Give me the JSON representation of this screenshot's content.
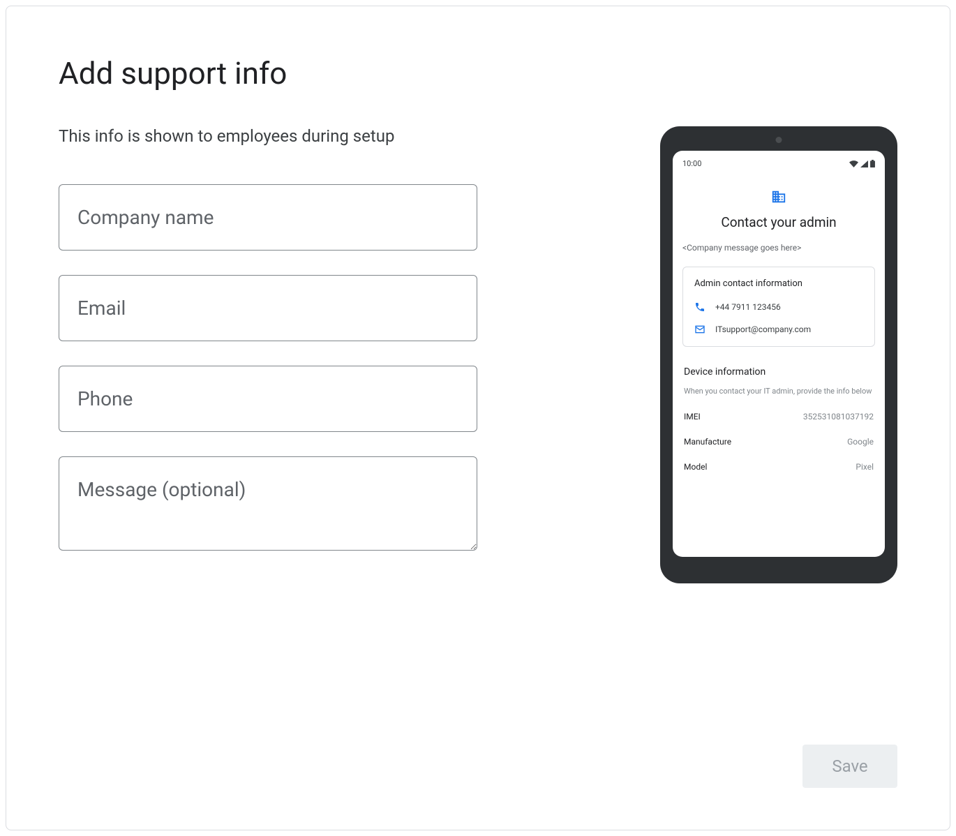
{
  "header": {
    "title": "Add support info",
    "subtitle": "This info is shown to employees during setup"
  },
  "form": {
    "company_placeholder": "Company name",
    "email_placeholder": "Email",
    "phone_placeholder": "Phone",
    "message_placeholder": "Message (optional)"
  },
  "preview": {
    "status_time": "10:00",
    "admin_title": "Contact your admin",
    "company_message": "<Company message goes here>",
    "contact_card_title": "Admin contact information",
    "phone_value": "+44 7911 123456",
    "email_value": "ITsupport@company.com",
    "device_title": "Device information",
    "device_hint": "When you contact your IT admin, provide the info below",
    "device_rows": [
      {
        "label": "IMEI",
        "value": "352531081037192"
      },
      {
        "label": "Manufacture",
        "value": "Google"
      },
      {
        "label": "Model",
        "value": "Pixel"
      }
    ]
  },
  "actions": {
    "save_label": "Save"
  }
}
